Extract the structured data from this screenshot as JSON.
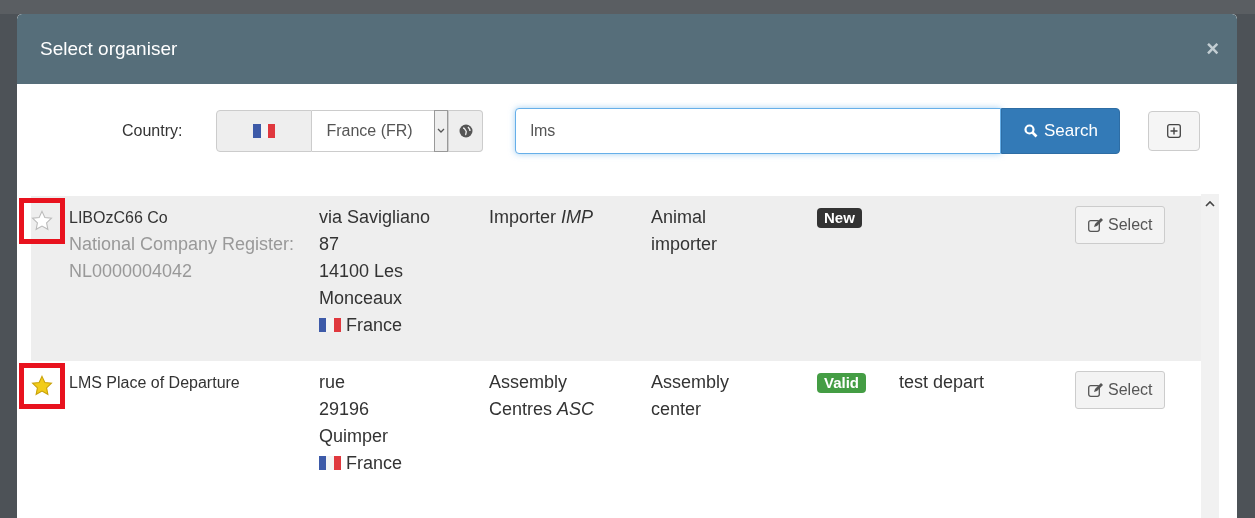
{
  "dialog": {
    "title": "Select organiser",
    "close": "×"
  },
  "filter": {
    "country_label": "Country:",
    "country_value": "France (FR)",
    "search_value": "lms",
    "search_button": "Search"
  },
  "rows": [
    {
      "starred": false,
      "highlighted": true,
      "name": "LIBOzC66 Co",
      "register": "National Company Register: NL0000004042",
      "address_lines": [
        "via Savigliano",
        "87",
        "14100 Les",
        "Monceaux"
      ],
      "country": "France",
      "type": "Importer *IMP*",
      "description": "Animal importer",
      "status": {
        "label": "New",
        "color": "#333333"
      },
      "comment": "",
      "button": "Select"
    },
    {
      "starred": true,
      "highlighted": false,
      "name": "LMS Place of Departure",
      "register": "",
      "address_lines": [
        "rue",
        "29196",
        "Quimper"
      ],
      "country": "France",
      "type": "Assembly Centres *ASC*",
      "description": "Assembly center",
      "status": {
        "label": "Valid",
        "color": "#449d44"
      },
      "comment": "test depart",
      "button": "Select"
    }
  ]
}
